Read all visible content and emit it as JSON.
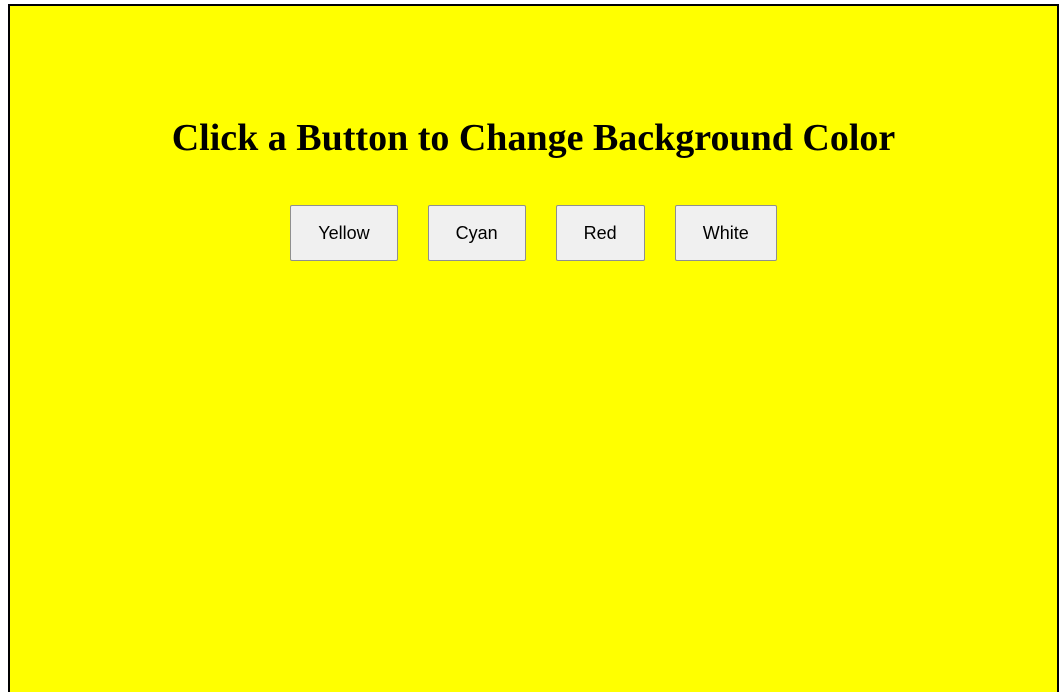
{
  "page": {
    "title": "Click a Button to Change Background Color",
    "background_color": "#ffff00"
  },
  "buttons": [
    {
      "label": "Yellow",
      "color": "yellow"
    },
    {
      "label": "Cyan",
      "color": "cyan"
    },
    {
      "label": "Red",
      "color": "red"
    },
    {
      "label": "White",
      "color": "white"
    }
  ]
}
